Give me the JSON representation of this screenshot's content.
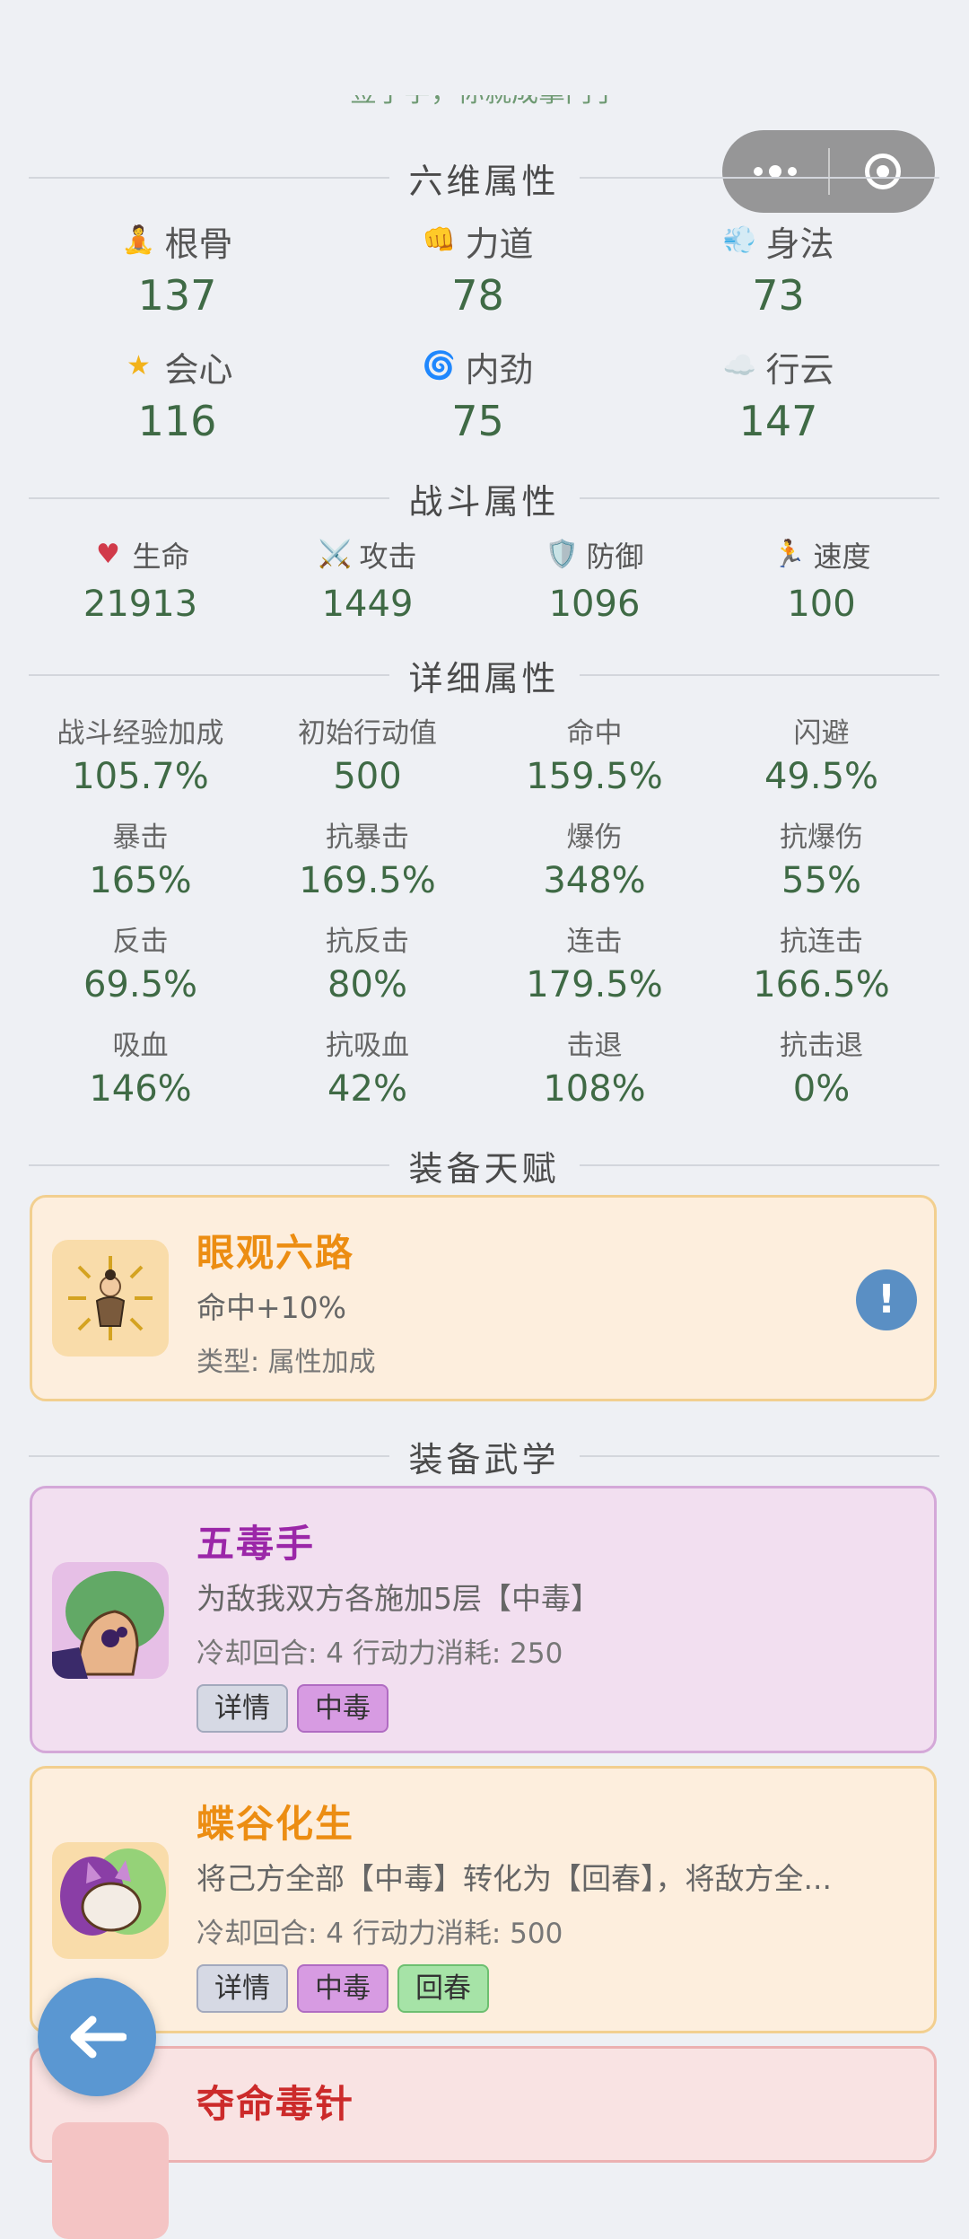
{
  "top_cut_text": "签了字，你就成掌门了",
  "capsule": {
    "more_icon": "more-dots-icon",
    "close_icon": "target-circle-icon"
  },
  "sections": {
    "six": "六维属性",
    "battle": "战斗属性",
    "detail": "详细属性",
    "talent": "装备天赋",
    "martial": "装备武学"
  },
  "six_attributes": [
    {
      "icon": "meditation-icon",
      "label": "根骨",
      "value": "137"
    },
    {
      "icon": "fist-icon",
      "label": "力道",
      "value": "78"
    },
    {
      "icon": "wind-icon",
      "label": "身法",
      "value": "73"
    },
    {
      "icon": "star-icon",
      "label": "会心",
      "value": "116"
    },
    {
      "icon": "swirl-icon",
      "label": "内劲",
      "value": "75"
    },
    {
      "icon": "cloud-icon",
      "label": "行云",
      "value": "147"
    }
  ],
  "battle_attributes": [
    {
      "icon": "heart-icon",
      "label": "生命",
      "value": "21913"
    },
    {
      "icon": "swords-icon",
      "label": "攻击",
      "value": "1449"
    },
    {
      "icon": "shield-icon",
      "label": "防御",
      "value": "1096"
    },
    {
      "icon": "runner-icon",
      "label": "速度",
      "value": "100"
    }
  ],
  "detail_attributes": [
    {
      "label": "战斗经验加成",
      "value": "105.7%"
    },
    {
      "label": "初始行动值",
      "value": "500"
    },
    {
      "label": "命中",
      "value": "159.5%"
    },
    {
      "label": "闪避",
      "value": "49.5%"
    },
    {
      "label": "暴击",
      "value": "165%"
    },
    {
      "label": "抗暴击",
      "value": "169.5%"
    },
    {
      "label": "爆伤",
      "value": "348%"
    },
    {
      "label": "抗爆伤",
      "value": "55%"
    },
    {
      "label": "反击",
      "value": "69.5%"
    },
    {
      "label": "抗反击",
      "value": "80%"
    },
    {
      "label": "连击",
      "value": "179.5%"
    },
    {
      "label": "抗连击",
      "value": "166.5%"
    },
    {
      "label": "吸血",
      "value": "146%"
    },
    {
      "label": "抗吸血",
      "value": "42%"
    },
    {
      "label": "击退",
      "value": "108%"
    },
    {
      "label": "抗击退",
      "value": "0%"
    }
  ],
  "talent": {
    "name": "眼观六路",
    "desc": "命中+10%",
    "type_text": "类型: 属性加成",
    "info_label": "!"
  },
  "martial": [
    {
      "name": "五毒手",
      "desc": "为敌我双方各施加5层【中毒】",
      "meta": "冷却回合: 4  行动力消耗: 250",
      "tags": [
        "详情",
        "中毒"
      ]
    },
    {
      "name": "蝶谷化生",
      "desc": "将己方全部【中毒】转化为【回春】，将敌方全...",
      "meta": "冷却回合: 4  行动力消耗: 500",
      "tags": [
        "详情",
        "中毒",
        "回春"
      ]
    },
    {
      "name": "夺命毒针"
    }
  ],
  "colors": {
    "talent_bg": "#fdeedd",
    "talent_border": "#f2cf8f",
    "talent_title": "#ec8d12",
    "purple_bg": "#f2dff0",
    "purple_border": "#d4a8d8",
    "purple_title": "#9b27a8",
    "orange_bg": "#fdeedd",
    "orange_border": "#f2cf8f",
    "orange_title": "#ec8d12",
    "red_bg": "#f9e3e3",
    "red_border": "#ecb1b1",
    "red_title": "#cc2a2a",
    "value_green": "#3f6a45"
  },
  "back_button_icon": "arrow-left-icon"
}
